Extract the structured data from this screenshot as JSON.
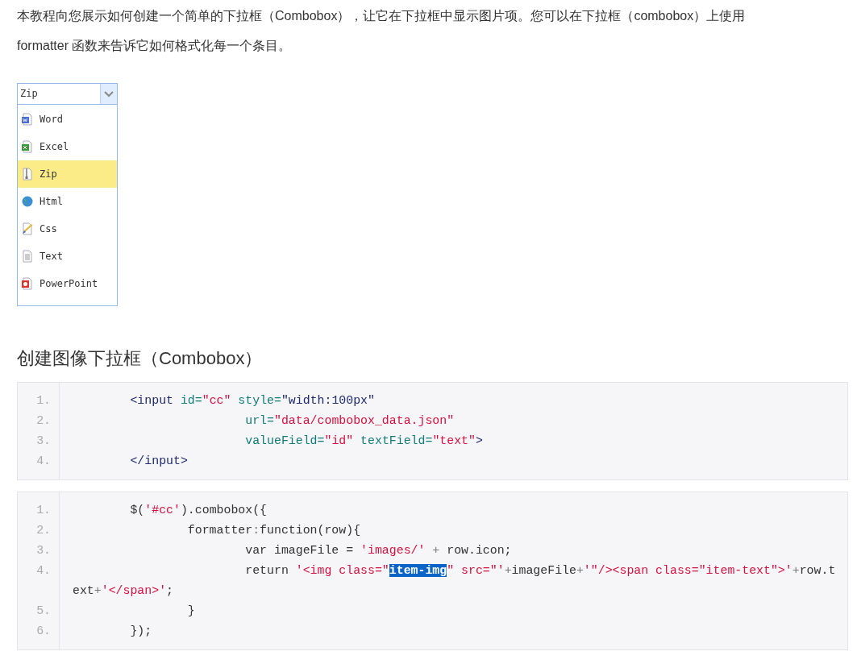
{
  "intro": "本教程向您展示如何创建一个简单的下拉框（Combobox），让它在下拉框中显示图片项。您可以在下拉框（combobox）上使用 formatter 函数来告诉它如何格式化每一个条目。",
  "combobox": {
    "value": "Zip",
    "items": [
      {
        "label": "Word",
        "kind": "word",
        "selected": false
      },
      {
        "label": "Excel",
        "kind": "excel",
        "selected": false
      },
      {
        "label": "Zip",
        "kind": "zip",
        "selected": true
      },
      {
        "label": "Html",
        "kind": "html",
        "selected": false
      },
      {
        "label": "Css",
        "kind": "css",
        "selected": false
      },
      {
        "label": "Text",
        "kind": "text",
        "selected": false
      },
      {
        "label": "PowerPoint",
        "kind": "powerpoint",
        "selected": false
      }
    ]
  },
  "heading": "创建图像下拉框（Combobox）",
  "code_blocks": [
    {
      "lines": [
        {
          "number": "1.",
          "tokens": [
            {
              "kind": "tag",
              "text": "        <input"
            },
            {
              "kind": "attr",
              "text": " id="
            },
            {
              "kind": "string",
              "text": "\"cc\""
            },
            {
              "kind": "attr",
              "text": " style="
            },
            {
              "kind": "tag",
              "text": "\"width:100px\""
            }
          ]
        },
        {
          "number": "2.",
          "tokens": [
            {
              "kind": "attr",
              "text": "                        url="
            },
            {
              "kind": "string",
              "text": "\"data/combobox_data.json\""
            }
          ]
        },
        {
          "number": "3.",
          "tokens": [
            {
              "kind": "attr",
              "text": "                        valueField="
            },
            {
              "kind": "string",
              "text": "\"id\""
            },
            {
              "kind": "attr",
              "text": " textField="
            },
            {
              "kind": "string",
              "text": "\"text\""
            },
            {
              "kind": "tag",
              "text": ">"
            }
          ]
        },
        {
          "number": "4.",
          "tokens": [
            {
              "kind": "tag",
              "text": "        </input>"
            }
          ]
        }
      ]
    },
    {
      "lines": [
        {
          "number": "1.",
          "tokens": [
            {
              "kind": "plain",
              "text": "        $("
            },
            {
              "kind": "string",
              "text": "'#cc'"
            },
            {
              "kind": "plain",
              "text": ").combobox({"
            }
          ]
        },
        {
          "number": "2.",
          "tokens": [
            {
              "kind": "plain",
              "text": "                formatter"
            },
            {
              "kind": "punct",
              "text": ":"
            },
            {
              "kind": "plain",
              "text": "function(row){"
            }
          ]
        },
        {
          "number": "3.",
          "tokens": [
            {
              "kind": "plain",
              "text": "                        var imageFile = "
            },
            {
              "kind": "string",
              "text": "'images/'"
            },
            {
              "kind": "punct",
              "text": " + "
            },
            {
              "kind": "plain",
              "text": "row.icon;"
            }
          ]
        },
        {
          "number": "4.",
          "tokens": [
            {
              "kind": "plain",
              "text": "                        return "
            },
            {
              "kind": "string",
              "text": "'<img class=\""
            },
            {
              "kind": "selected",
              "text": "item-img"
            },
            {
              "kind": "string",
              "text": "\" src=\"'"
            },
            {
              "kind": "punct",
              "text": "+"
            },
            {
              "kind": "plain",
              "text": "imageFile"
            },
            {
              "kind": "punct",
              "text": "+"
            },
            {
              "kind": "string",
              "text": "'\"/><span class=\"item-text\">'"
            },
            {
              "kind": "punct",
              "text": "+"
            },
            {
              "kind": "plain",
              "text": "row.text"
            },
            {
              "kind": "punct",
              "text": "+"
            },
            {
              "kind": "string",
              "text": "'</span>'"
            },
            {
              "kind": "plain",
              "text": ";"
            }
          ]
        },
        {
          "number": "5.",
          "tokens": [
            {
              "kind": "plain",
              "text": "                }"
            }
          ]
        },
        {
          "number": "6.",
          "tokens": [
            {
              "kind": "plain",
              "text": "        });"
            }
          ]
        }
      ]
    }
  ]
}
